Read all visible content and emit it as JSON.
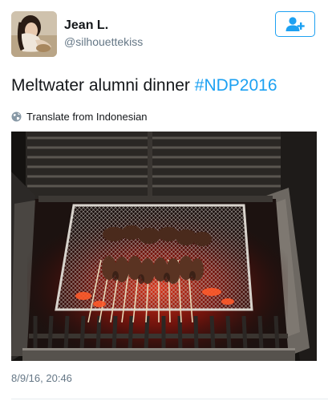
{
  "author": {
    "name": "Jean L.",
    "handle": "@silhouettekiss"
  },
  "follow_button": {
    "icon": "follow-user-icon",
    "color": "#1da1f2"
  },
  "tweet": {
    "text": "Meltwater alumni dinner ",
    "hashtag": "#NDP2016",
    "hashtag_color": "#1da1f2",
    "translate_label": "Translate from Indonesian",
    "timestamp": "8/9/16, 20:46"
  },
  "media": {
    "icon": "photo-grill-skewers"
  }
}
